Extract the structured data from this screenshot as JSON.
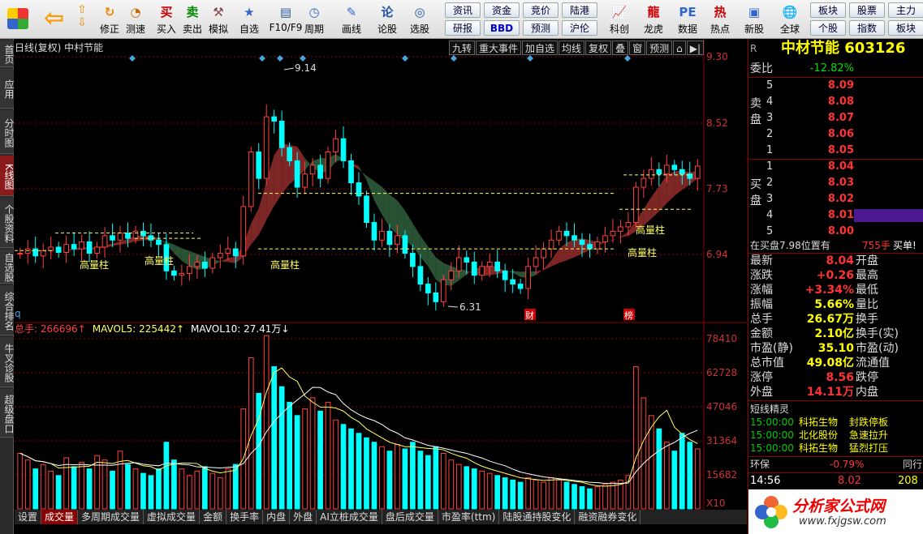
{
  "toolbar": {
    "left_buttons": [
      {
        "label": "修正",
        "icon": "up-down-arrows-icon"
      },
      {
        "label": "测速",
        "icon": "clock-icon"
      },
      {
        "label": "买入",
        "icon": "buy-icon"
      },
      {
        "label": "卖出",
        "icon": "sell-icon"
      },
      {
        "label": "模拟",
        "icon": "gavel-icon"
      },
      {
        "label": "自选",
        "icon": "star-icon"
      },
      {
        "label": "F10/F9",
        "icon": "document-icon"
      },
      {
        "label": "周期",
        "icon": "cycle-icon"
      },
      {
        "label": "画线",
        "icon": "pencil-icon"
      },
      {
        "label": "论股",
        "icon": "forum-icon"
      },
      {
        "label": "选股",
        "icon": "screener-icon"
      }
    ],
    "grid_buttons": [
      [
        "资讯",
        "资金",
        "竞价",
        "陆港"
      ],
      [
        "研报",
        "BBD",
        "预测",
        "沪伦"
      ]
    ],
    "right_buttons": [
      {
        "label": "科创",
        "icon": "chart-icon"
      },
      {
        "label": "龙虎",
        "icon": "dragon-tiger-icon"
      },
      {
        "label": "数据",
        "icon": "pe-icon"
      },
      {
        "label": "热点",
        "icon": "hot-icon"
      },
      {
        "label": "新股",
        "icon": "new-stock-icon"
      },
      {
        "label": "全球",
        "icon": "globe-icon"
      }
    ],
    "far_right": [
      [
        "板块",
        "股票",
        "主力"
      ],
      [
        "个股",
        "指数",
        "板块"
      ]
    ]
  },
  "side_tabs": [
    "首页",
    "应用",
    "分时图",
    "K线图",
    "个股资料",
    "自选股",
    "综合排名",
    "牛叉诊股",
    "超级盘口"
  ],
  "side_active": 3,
  "chart": {
    "header": "日线(复权)  中村节能",
    "tools": [
      "九转",
      "重大事件",
      "加自选",
      "均线",
      "复权",
      "叠",
      "窗",
      "预测",
      "⌂",
      "▶|"
    ],
    "price_axis": [
      "9.30",
      "8.52",
      "7.73",
      "6.94"
    ],
    "high_label": "9.14",
    "low_label": "6.31",
    "tags": [
      "高量柱",
      "高量柱",
      "高量柱",
      "高量柱",
      "高量柱"
    ],
    "markers": [
      "财",
      "榜"
    ],
    "left_q": "q",
    "vol_header": {
      "total": "总手: 266696↑",
      "mavol5": "MAVOL5: 225442↑",
      "mavol10": "MAVOL10: 27.41万↓"
    },
    "vol_axis": [
      "78410",
      "62728",
      "47046",
      "31364",
      "15682"
    ],
    "vol_unit": "X10",
    "bottom_tabs": [
      "设置",
      "成交量",
      "多周期成交量",
      "虚拟成交量",
      "金额",
      "换手率",
      "内盘",
      "外盘",
      "AI立桩成交量",
      "盘后成交量",
      "市盈率(ttm)",
      "陆股通持股变化",
      "融资融券变化"
    ],
    "bottom_active": 1
  },
  "chart_data": {
    "type": "candlestick",
    "close": [
      7.05,
      7.1,
      7.02,
      7.08,
      7.12,
      7.06,
      7.15,
      7.1,
      7.18,
      7.05,
      7.12,
      7.25,
      7.2,
      7.28,
      7.22,
      7.3,
      7.25,
      7.2,
      7.15,
      6.85,
      6.8,
      6.82,
      6.9,
      6.95,
      6.88,
      7.0,
      7.05,
      7.1,
      7.02,
      7.58,
      8.2,
      7.9,
      8.6,
      8.55,
      8.25,
      8.1,
      7.8,
      7.95,
      8.05,
      7.9,
      8.2,
      8.35,
      8.1,
      7.85,
      7.7,
      7.4,
      7.2,
      7.3,
      7.15,
      7.25,
      7.05,
      6.9,
      6.7,
      6.6,
      6.5,
      6.75,
      6.85,
      7.0,
      6.95,
      6.8,
      6.9,
      6.95,
      6.85,
      6.75,
      6.7,
      6.65,
      6.9,
      7.0,
      7.1,
      7.2,
      7.3,
      7.25,
      7.2,
      7.15,
      7.1,
      7.18,
      7.25,
      7.3,
      7.35,
      7.4,
      7.8,
      7.9,
      8.0,
      7.95,
      8.05,
      8.0,
      7.95,
      7.9,
      8.04
    ],
    "volume": [
      25000,
      22000,
      18000,
      20000,
      17000,
      15000,
      23000,
      19000,
      21000,
      18000,
      24000,
      22000,
      17000,
      26000,
      20000,
      18000,
      16000,
      15000,
      18000,
      30000,
      22000,
      18000,
      15000,
      17000,
      19000,
      16000,
      14000,
      18000,
      20000,
      45000,
      68000,
      52000,
      78000,
      64000,
      55000,
      48000,
      42000,
      45000,
      50000,
      44000,
      48000,
      40000,
      38000,
      36000,
      34000,
      32000,
      30000,
      28000,
      26000,
      29000,
      27000,
      30000,
      26000,
      24000,
      28000,
      25000,
      22000,
      20000,
      19000,
      18000,
      17000,
      16000,
      15000,
      14000,
      13000,
      12000,
      14000,
      13000,
      12000,
      14000,
      13000,
      12000,
      11000,
      10000,
      9000,
      10000,
      11000,
      12000,
      13000,
      15000,
      64000,
      50000,
      42000,
      36000,
      30000,
      26000,
      34000,
      30000,
      27000
    ],
    "ylim": [
      6.31,
      9.3
    ],
    "vol_ylim": [
      0,
      78410
    ]
  },
  "right_panel": {
    "title": "中材节能 603126",
    "r_label": "R",
    "weibi": {
      "label": "委比",
      "value": "-12.82%"
    },
    "sell_label": "卖盘",
    "buy_label": "买盘",
    "sell": [
      {
        "n": "5",
        "p": "8.09"
      },
      {
        "n": "4",
        "p": "8.08"
      },
      {
        "n": "3",
        "p": "8.07"
      },
      {
        "n": "2",
        "p": "8.06"
      },
      {
        "n": "1",
        "p": "8.05"
      }
    ],
    "buy": [
      {
        "n": "1",
        "p": "8.04"
      },
      {
        "n": "2",
        "p": "8.03"
      },
      {
        "n": "3",
        "p": "8.02"
      },
      {
        "n": "4",
        "p": "8.01"
      },
      {
        "n": "5",
        "p": "8.00"
      }
    ],
    "buy_note": "在买盘7.98位置有",
    "buy_note2": "755手",
    "buy_note3": "买单!",
    "stats": [
      {
        "l": "最新",
        "v": "8.04",
        "c": "red",
        "r": "开盘"
      },
      {
        "l": "涨跌",
        "v": "+0.26",
        "c": "red",
        "r": "最高"
      },
      {
        "l": "涨幅",
        "v": "+3.34%",
        "c": "red",
        "r": "最低"
      },
      {
        "l": "振幅",
        "v": "5.66%",
        "c": "yel",
        "r": "量比"
      },
      {
        "l": "总手",
        "v": "26.67万",
        "c": "yel",
        "r": "换手"
      },
      {
        "l": "金额",
        "v": "2.10亿",
        "c": "yel",
        "r": "换手(实)"
      },
      {
        "l": "市盈(静)",
        "v": "35.10",
        "c": "yel",
        "r": "市盈(动)"
      },
      {
        "l": "总市值",
        "v": "49.08亿",
        "c": "yel",
        "r": "流通值"
      },
      {
        "l": "涨停",
        "v": "8.56",
        "c": "red",
        "r": "跌停"
      },
      {
        "l": "外盘",
        "v": "14.11万",
        "c": "red",
        "r": "内盘"
      }
    ],
    "sprite_title": "短线精灵",
    "sprites": [
      {
        "t": "15:00:00",
        "s": "科拓生物",
        "e": "封跌停板"
      },
      {
        "t": "15:00:00",
        "s": "北化股份",
        "e": "急速拉升"
      },
      {
        "t": "15:00:00",
        "s": "科拓生物",
        "e": "猛烈打压"
      }
    ],
    "env": {
      "label": "环保",
      "value": "-0.79%",
      "tail": "同行"
    },
    "tick": {
      "time": "14:56",
      "price": "8.02",
      "vol": "208"
    },
    "logo": {
      "name": "分析家公式网",
      "url": "www.fxjgsw.com"
    }
  }
}
